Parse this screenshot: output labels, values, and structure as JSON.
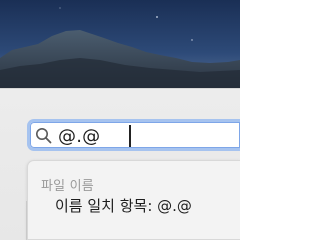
{
  "search": {
    "value": "@.@",
    "icon": "magnifying-glass-icon"
  },
  "suggestions": {
    "section_header": "파일 이름",
    "item_label": "이름 일치 항목: @.@"
  }
}
